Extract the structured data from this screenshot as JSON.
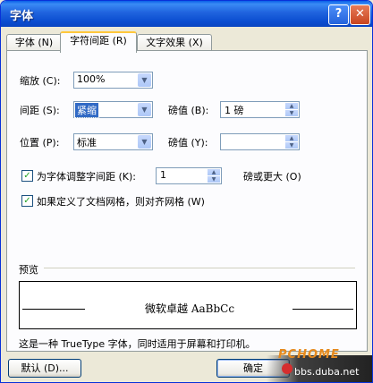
{
  "window": {
    "title": "字体",
    "help": "?",
    "close": "✕"
  },
  "tabs": [
    {
      "label": "字体 (N)"
    },
    {
      "label": "字符间距 (R)"
    },
    {
      "label": "文字效果 (X)"
    }
  ],
  "fields": {
    "scale": {
      "label": "缩放 (C):",
      "value": "100%"
    },
    "spacing": {
      "label": "间距 (S):",
      "value": "紧缩"
    },
    "spacing_by": {
      "label": "磅值 (B):",
      "value": "1 磅"
    },
    "position": {
      "label": "位置 (P):",
      "value": "标准"
    },
    "position_by": {
      "label": "磅值 (Y):",
      "value": ""
    },
    "kerning": {
      "label": "为字体调整字间距 (K):",
      "value": "1",
      "suffix": "磅或更大 (O)",
      "checked": true
    },
    "snap_grid": {
      "label": "如果定义了文档网格，则对齐网格 (W)",
      "checked": true
    }
  },
  "preview": {
    "label": "预览",
    "sample": "微软卓越 AaBbCc"
  },
  "note": "这是一种 TrueType 字体，同时适用于屏幕和打印机。",
  "buttons": {
    "default": "默认 (D)...",
    "ok": "确定"
  },
  "watermark": {
    "logo": "PCHOME",
    "site": "bbs.duba.net"
  },
  "colors": {
    "titlebar": "#0a5fe8",
    "selection": "#316ac5",
    "tab_highlight": "#ffc83c"
  }
}
